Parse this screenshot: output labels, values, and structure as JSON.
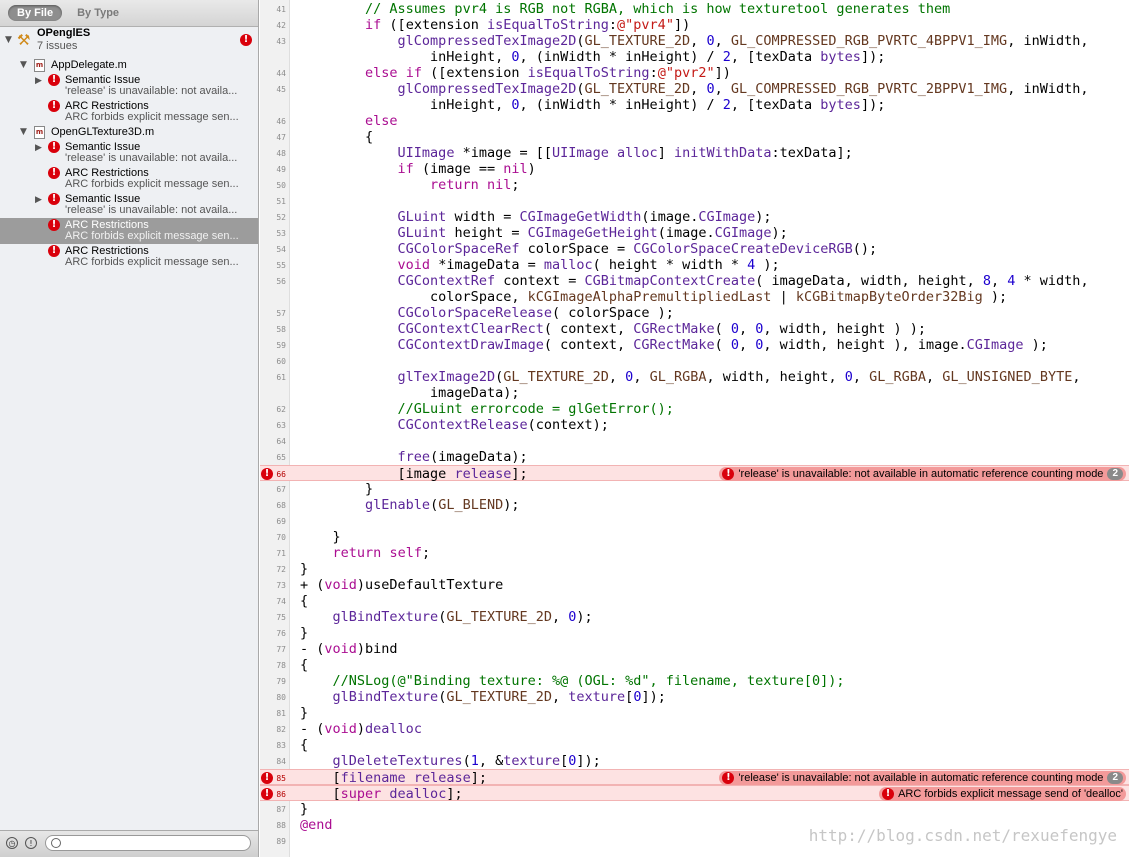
{
  "navigator": {
    "scope_by_file": "By File",
    "scope_by_type": "By Type",
    "project": {
      "name": "OPenglES",
      "issue_count": "7 issues"
    },
    "files": [
      {
        "name": "AppDelegate.m",
        "issues": [
          {
            "title": "Semantic Issue",
            "detail": "'release' is unavailable: not availa...",
            "expandable": true
          },
          {
            "title": "ARC Restrictions",
            "detail": "ARC forbids explicit message sen...",
            "expandable": false
          }
        ]
      },
      {
        "name": "OpenGLTexture3D.m",
        "issues": [
          {
            "title": "Semantic Issue",
            "detail": "'release' is unavailable: not availa...",
            "expandable": true
          },
          {
            "title": "ARC Restrictions",
            "detail": "ARC forbids explicit message sen...",
            "expandable": false
          },
          {
            "title": "Semantic Issue",
            "detail": "'release' is unavailable: not availa...",
            "expandable": true
          },
          {
            "title": "ARC Restrictions",
            "detail": "ARC forbids explicit message sen...",
            "expandable": false,
            "selected": true
          },
          {
            "title": "ARC Restrictions",
            "detail": "ARC forbids explicit message sen...",
            "expandable": false
          }
        ]
      }
    ]
  },
  "editor": {
    "lines": [
      {
        "n": "41",
        "t": "        // Assumes pvr4 is RGB not RGBA, which is how texturetool generates them"
      },
      {
        "n": "42",
        "t": "        if ([extension isEqualToString:@\"pvr4\"])"
      },
      {
        "n": "43",
        "t": "            glCompressedTexImage2D(GL_TEXTURE_2D, 0, GL_COMPRESSED_RGB_PVRTC_4BPPV1_IMG, inWidth,"
      },
      {
        "n": "",
        "t": "                inHeight, 0, (inWidth * inHeight) / 2, [texData bytes]);"
      },
      {
        "n": "44",
        "t": "        else if ([extension isEqualToString:@\"pvr2\"])"
      },
      {
        "n": "45",
        "t": "            glCompressedTexImage2D(GL_TEXTURE_2D, 0, GL_COMPRESSED_RGB_PVRTC_2BPPV1_IMG, inWidth,"
      },
      {
        "n": "",
        "t": "                inHeight, 0, (inWidth * inHeight) / 2, [texData bytes]);"
      },
      {
        "n": "46",
        "t": "        else"
      },
      {
        "n": "47",
        "t": "        {"
      },
      {
        "n": "48",
        "t": "            UIImage *image = [[UIImage alloc] initWithData:texData];"
      },
      {
        "n": "49",
        "t": "            if (image == nil)"
      },
      {
        "n": "50",
        "t": "                return nil;"
      },
      {
        "n": "51",
        "t": ""
      },
      {
        "n": "52",
        "t": "            GLuint width = CGImageGetWidth(image.CGImage);"
      },
      {
        "n": "53",
        "t": "            GLuint height = CGImageGetHeight(image.CGImage);"
      },
      {
        "n": "54",
        "t": "            CGColorSpaceRef colorSpace = CGColorSpaceCreateDeviceRGB();"
      },
      {
        "n": "55",
        "t": "            void *imageData = malloc( height * width * 4 );"
      },
      {
        "n": "56",
        "t": "            CGContextRef context = CGBitmapContextCreate( imageData, width, height, 8, 4 * width,"
      },
      {
        "n": "",
        "t": "                colorSpace, kCGImageAlphaPremultipliedLast | kCGBitmapByteOrder32Big );"
      },
      {
        "n": "57",
        "t": "            CGColorSpaceRelease( colorSpace );"
      },
      {
        "n": "58",
        "t": "            CGContextClearRect( context, CGRectMake( 0, 0, width, height ) );"
      },
      {
        "n": "59",
        "t": "            CGContextDrawImage( context, CGRectMake( 0, 0, width, height ), image.CGImage );"
      },
      {
        "n": "60",
        "t": ""
      },
      {
        "n": "61",
        "t": "            glTexImage2D(GL_TEXTURE_2D, 0, GL_RGBA, width, height, 0, GL_RGBA, GL_UNSIGNED_BYTE,"
      },
      {
        "n": "",
        "t": "                imageData);"
      },
      {
        "n": "62",
        "t": "            //GLuint errorcode = glGetError();"
      },
      {
        "n": "63",
        "t": "            CGContextRelease(context);"
      },
      {
        "n": "64",
        "t": ""
      },
      {
        "n": "65",
        "t": "            free(imageData);"
      },
      {
        "n": "66",
        "t": "            [image release];",
        "error": {
          "message": "'release' is unavailable: not available in automatic reference counting mode",
          "count": "2"
        }
      },
      {
        "n": "67",
        "t": "        }"
      },
      {
        "n": "68",
        "t": "        glEnable(GL_BLEND);"
      },
      {
        "n": "69",
        "t": ""
      },
      {
        "n": "70",
        "t": "    }"
      },
      {
        "n": "71",
        "t": "    return self;"
      },
      {
        "n": "72",
        "t": "}"
      },
      {
        "n": "73",
        "t": "+ (void)useDefaultTexture"
      },
      {
        "n": "74",
        "t": "{"
      },
      {
        "n": "75",
        "t": "    glBindTexture(GL_TEXTURE_2D, 0);"
      },
      {
        "n": "76",
        "t": "}"
      },
      {
        "n": "77",
        "t": "- (void)bind"
      },
      {
        "n": "78",
        "t": "{"
      },
      {
        "n": "79",
        "t": "    //NSLog(@\"Binding texture: %@ (OGL: %d\", filename, texture[0]);"
      },
      {
        "n": "80",
        "t": "    glBindTexture(GL_TEXTURE_2D, texture[0]);"
      },
      {
        "n": "81",
        "t": "}"
      },
      {
        "n": "82",
        "t": "- (void)dealloc"
      },
      {
        "n": "83",
        "t": "{"
      },
      {
        "n": "84",
        "t": "    glDeleteTextures(1, &texture[0]);"
      },
      {
        "n": "85",
        "t": "    [filename release];",
        "error": {
          "message": "'release' is unavailable: not available in automatic reference counting mode",
          "count": "2"
        }
      },
      {
        "n": "86",
        "t": "    [super dealloc];",
        "error": {
          "message": "ARC forbids explicit message send of 'dealloc'",
          "count": ""
        }
      },
      {
        "n": "87",
        "t": "}"
      },
      {
        "n": "88",
        "t": "@end"
      },
      {
        "n": "89",
        "t": ""
      }
    ]
  },
  "watermark": "http://blog.csdn.net/rexuefengye",
  "icons": {
    "error": "error-icon",
    "disclosure": "disclosure-triangle-icon",
    "file": "objc-file-icon",
    "project": "xcode-project-icon"
  },
  "colors": {
    "error_line": "#fde2e2",
    "error_badge": "#f39a9a",
    "error_icon": "#d9000b",
    "comment": "#007400",
    "keyword": "#aa0d91",
    "string": "#c41a16",
    "number": "#1c00cf",
    "type": "#5c2699",
    "function": "#26474b",
    "macro": "#643820"
  }
}
